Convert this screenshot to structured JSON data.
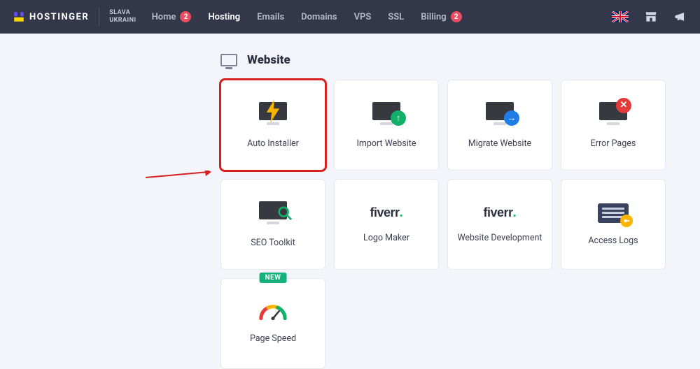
{
  "brand": {
    "name": "HOSTINGER"
  },
  "slogan": {
    "line1": "SLAVA",
    "line2": "UKRAINI"
  },
  "nav": {
    "home": {
      "label": "Home",
      "badge": "2"
    },
    "hosting": {
      "label": "Hosting",
      "active": true
    },
    "emails": {
      "label": "Emails"
    },
    "domains": {
      "label": "Domains"
    },
    "vps": {
      "label": "VPS"
    },
    "ssl": {
      "label": "SSL"
    },
    "billing": {
      "label": "Billing",
      "badge": "2"
    }
  },
  "locale": {
    "flag": "uk"
  },
  "section": {
    "title": "Website"
  },
  "cards": {
    "auto_installer": {
      "label": "Auto Installer"
    },
    "import_website": {
      "label": "Import Website"
    },
    "migrate_website": {
      "label": "Migrate Website"
    },
    "error_pages": {
      "label": "Error Pages"
    },
    "seo_toolkit": {
      "label": "SEO Toolkit"
    },
    "logo_maker": {
      "label": "Logo Maker",
      "brand": "fiverr"
    },
    "web_dev": {
      "label": "Website Development",
      "brand": "fiverr"
    },
    "access_logs": {
      "label": "Access Logs"
    },
    "page_speed": {
      "label": "Page Speed",
      "badge": "NEW"
    }
  },
  "annotation": {
    "highlight_card": "auto_installer"
  }
}
